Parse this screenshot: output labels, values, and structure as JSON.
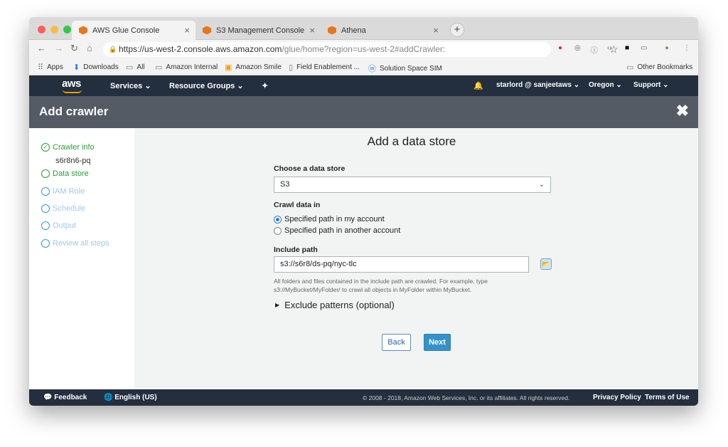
{
  "browser": {
    "tabs": [
      {
        "label": "AWS Glue Console",
        "active": true
      },
      {
        "label": "S3 Management Console",
        "active": false
      },
      {
        "label": "Athena",
        "active": false
      }
    ],
    "new_tab_label": "+",
    "url_host": "https://us-west-2.console.aws.amazon.com",
    "url_path": "/glue/home?region=us-west-2#addCrawler:",
    "bookmarks": [
      "Apps",
      "Downloads",
      "All",
      "Amazon Internal",
      "Amazon Smile",
      "Field Enablement ...",
      "Solution Space SIM"
    ],
    "other_bookmarks": "Other Bookmarks"
  },
  "aws_nav": {
    "logo": "aws",
    "services": "Services",
    "resource_groups": "Resource Groups",
    "account": "starlord @ sanjeetaws",
    "region": "Oregon",
    "support": "Support"
  },
  "page": {
    "title": "Add crawler",
    "close_glyph": "✖"
  },
  "steps": [
    {
      "label": "Crawler info",
      "state": "done"
    },
    {
      "label": "s6r8n6-pq",
      "state": "sub"
    },
    {
      "label": "Data store",
      "state": "current"
    },
    {
      "label": "IAM Role",
      "state": "pending"
    },
    {
      "label": "Schedule",
      "state": "pending"
    },
    {
      "label": "Output",
      "state": "pending"
    },
    {
      "label": "Review all steps",
      "state": "pending"
    }
  ],
  "form": {
    "heading": "Add a data store",
    "datastore_label": "Choose a data store",
    "datastore_value": "S3",
    "crawl_label": "Crawl data in",
    "radio_my_account": "Specified path in my account",
    "radio_other_account": "Specified path in another account",
    "include_label": "Include path",
    "include_value": "s3://s6r8/ds-pq/nyc-tlc",
    "hint_line1": "All folders and files contained in the include path are crawled. For example, type",
    "hint_line2": "s3://MyBucket/MyFolder/ to crawl all objects in MyFolder within MyBucket.",
    "exclude_label": "Exclude patterns (optional)",
    "back_label": "Back",
    "next_label": "Next"
  },
  "footer": {
    "feedback": "Feedback",
    "language": "English (US)",
    "copyright": "© 2008 - 2018, Amazon Web Services, Inc. or its affiliates. All rights reserved.",
    "privacy": "Privacy Policy",
    "terms": "Terms of Use"
  },
  "colors": {
    "aws_dark": "#232f3e",
    "title_band": "#545b64",
    "accent_orange": "#ff9900",
    "primary_blue": "#3592c9",
    "success_green": "#2a9d3a"
  }
}
